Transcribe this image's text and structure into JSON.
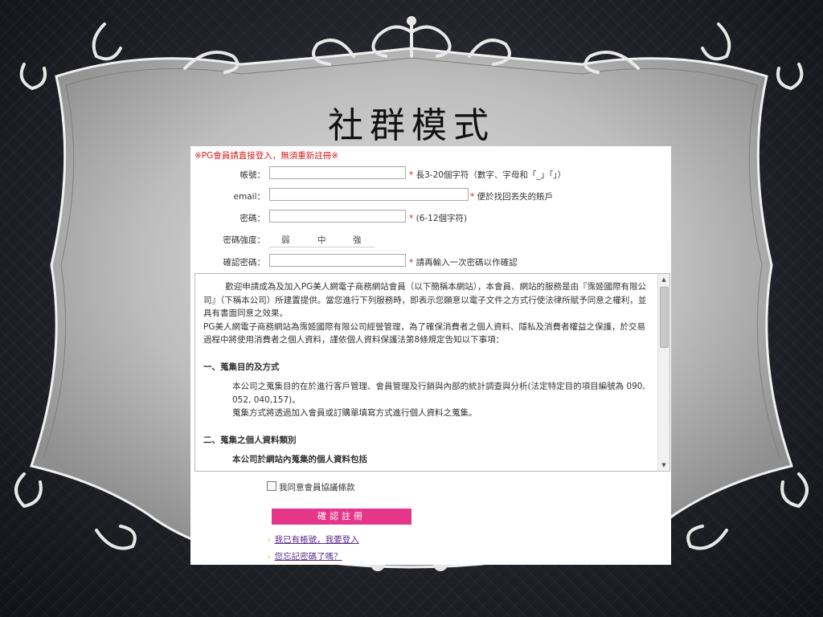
{
  "slide": {
    "title": "社群模式"
  },
  "form": {
    "notice": "※PG會員請直接登入，無須重新註冊※",
    "account": {
      "label": "帳號：",
      "value": "",
      "hint_star": "*",
      "hint": "長3-20個字符（數字、字母和「_」「」）"
    },
    "email": {
      "label": "email：",
      "value": "",
      "hint_star": "*",
      "hint": "便於找回丟失的賬戶"
    },
    "password": {
      "label": "密碼：",
      "value": "",
      "hint_star": "*",
      "hint": "(6-12個字符)"
    },
    "strength": {
      "label": "密碼強度：",
      "weak": "弱",
      "medium": "中",
      "strong": "強"
    },
    "confirm": {
      "label": "確認密碼：",
      "value": "",
      "hint_star": "*",
      "hint": "請再輸入一次密碼以作確認"
    }
  },
  "terms": {
    "para1": "歡迎申請成為及加入PG美人網電子商務網站會員（以下簡稱本網站），本會員、網站的服務是由『霈姬國際有限公司』（下稱本公司）所建置提供。當您進行下列服務時，即表示您願意以電子文件之方式行使法律所賦予同意之權利，並具有書面同意之效果。",
    "para2": "PG美人網電子商務網站為霈姬國際有限公司經營管理，為了確保消費者之個人資料、隱私及消費者權益之保護，於交易過程中將使用消費者之個人資料，謹依個人資料保護法第8條規定告知以下事項：",
    "section1": "一、蒐集目的及方式",
    "section1_text1": "本公司之蒐集目的在於進行客戶管理、會員管理及行銷與內部的統計調查與分析(法定特定目的項目編號為 090, 052, 040,157)。",
    "section1_text2": "蒐集方式將透過加入會員或訂購單填寫方式進行個人資料之蒐集。",
    "section2": "二、蒐集之個人資料類別",
    "section2_text1": "本公司於網站內蒐集的個人資料包括"
  },
  "agree": {
    "label": "我同意會員協議條款"
  },
  "submit": {
    "label": "確認註冊"
  },
  "links": {
    "have_account": "我已有帳號，我要登入",
    "forgot_password": "您忘記密碼了嗎？"
  },
  "colors": {
    "notice": "#d42020",
    "submit": "#e6368a",
    "link": "#5a2a8a",
    "frame": "#b8b8b8"
  }
}
